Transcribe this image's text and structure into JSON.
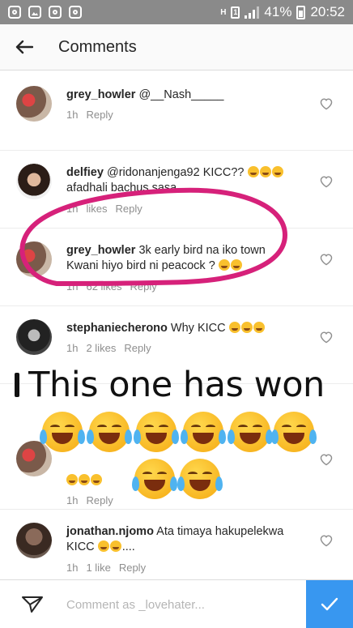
{
  "status_bar": {
    "battery": "41%",
    "time": "20:52",
    "sim_label": "1",
    "network": "H"
  },
  "header": {
    "title": "Comments"
  },
  "comments": [
    {
      "username": "grey_howler",
      "text": "@__Nash_____",
      "time": "1h",
      "likes": "",
      "reply": "Reply"
    },
    {
      "username": "delfiey",
      "text": "@ridonanjenga92 KICC??",
      "text2": "afadhali bachus sasa",
      "time": "1h",
      "likes": "likes",
      "reply": "Reply"
    },
    {
      "username": "grey_howler",
      "text": "3k early bird na iko town",
      "text2": "Kwani hiyo bird ni peacock ?",
      "time": "1h",
      "likes": "62 likes",
      "reply": "Reply"
    },
    {
      "username": "stephaniecherono",
      "text": "Why KICC",
      "time": "1h",
      "likes": "2 likes",
      "reply": "Reply"
    },
    {
      "username": "",
      "text": "",
      "time": "1h",
      "likes": "",
      "reply": "Reply"
    },
    {
      "username": "jonathan.njomo",
      "text": "Ata timaya hakupelekwa",
      "text2": "KICC",
      "text3": "....",
      "time": "1h",
      "likes": "1 like",
      "reply": "Reply"
    }
  ],
  "overlay": {
    "caption": "This one has won",
    "emoji": "face-with-tears-of-joy"
  },
  "composer": {
    "placeholder": "Comment as _lovehater..."
  },
  "colors": {
    "status_bar": "#8a8a8a",
    "header_bg": "#fafafa",
    "send_button": "#3897f0",
    "annotation": "#d6217a",
    "meta_text": "#8e8e8e"
  }
}
